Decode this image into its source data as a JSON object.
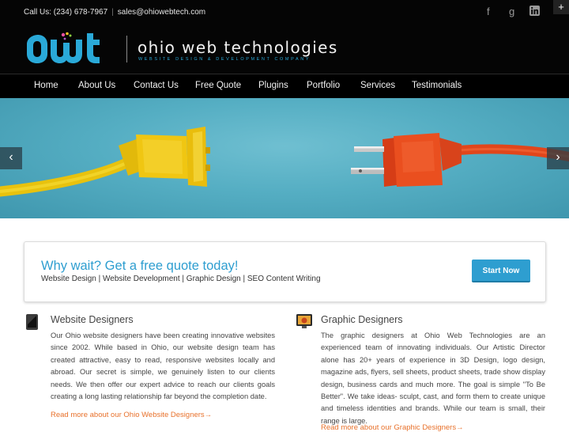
{
  "topbar": {
    "phone": "Call Us: (234) 678-7967",
    "separator": "|",
    "email": "sales@ohiowebtech.com",
    "social_icons": [
      "facebook-icon",
      "google-plus-icon",
      "linkedin-icon"
    ],
    "facebook_glyph": "f",
    "google_glyph": "g",
    "linkedin_glyph": "in",
    "corner_glyph": "+"
  },
  "logo": {
    "mark": "owt",
    "name": "ohio web technologies",
    "tagline": "WEBSITE DESIGN & DEVELOPMENT COMPANY"
  },
  "nav": {
    "items": [
      "Home",
      "About Us",
      "Contact Us",
      "Free Quote",
      "Plugins",
      "Portfolio",
      "Services",
      "Testimonials"
    ]
  },
  "slider": {
    "prev_glyph": "‹",
    "next_glyph": "›"
  },
  "cta": {
    "title": "Why wait? Get a free quote today!",
    "subtitle": "Website Design | Website Development | Graphic Design | SEO Content Writing",
    "button": "Start Now"
  },
  "columns": [
    {
      "title": "Website Designers",
      "text": "Our Ohio website designers have been creating innovative websites since 2002. While based in Ohio, our website design team has created attractive, easy to read, responsive websites locally and abroad. Our secret is simple, we genuinely listen to our clients needs. We then offer our expert advice to reach our clients goals creating a long lasting relationship far beyond the completion date.",
      "link": "Read more about our Ohio Website Designers→",
      "icon": "tablet-icon"
    },
    {
      "title": "Graphic Designers",
      "text": "The graphic designers at Ohio Web Technologies are an experienced team of innovating individuals. Our Artistic Director alone has 20+ years of experience in 3D Design, logo design, magazine ads, flyers, sell sheets, product sheets, trade show display design, business cards and much more. The goal is simple \"To Be Better\". We take ideas- sculpt, cast, and form them to create unique and timeless identities and brands. While our team is small, their range is large.",
      "link": "Read more about our Graphic Designers→",
      "icon": "monitor-icon"
    }
  ],
  "colors": {
    "accent": "#2e9ed0",
    "link": "#e8712b",
    "header_bg": "#050505"
  }
}
